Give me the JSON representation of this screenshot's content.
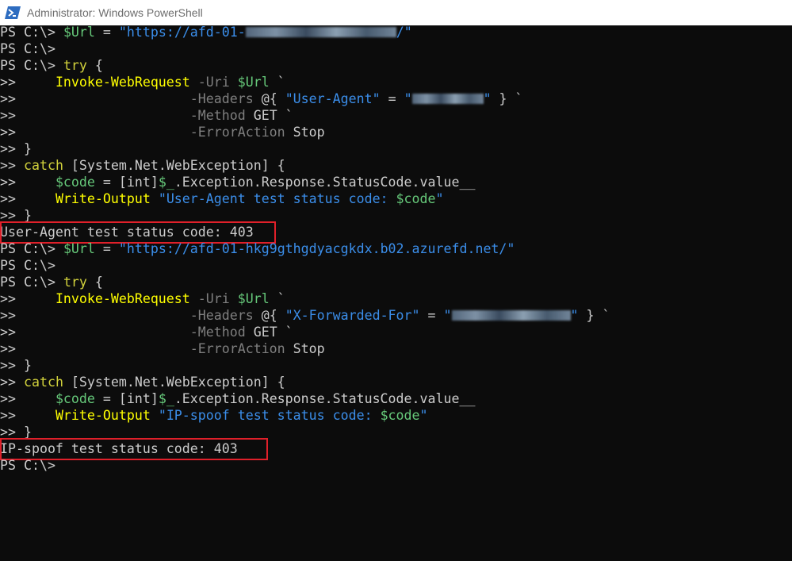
{
  "window": {
    "title": "Administrator: Windows PowerShell",
    "icon": "powershell-icon"
  },
  "colors": {
    "keyword": "#ffff00",
    "variable": "#66c97a",
    "string": "#3b8eea",
    "parameter": "#7f7f7f",
    "text": "#cccccc",
    "highlight": "#e0202a"
  },
  "console": {
    "l1": {
      "p1": "PS C:\\> ",
      "p2": "$Url",
      "p3": " = ",
      "p4": "\"https://afd-01-",
      "p6": "/\""
    },
    "l2": {
      "p1": "PS C:\\>"
    },
    "l3": {
      "p1": "PS C:\\> ",
      "p2": "try",
      "p3": " {"
    },
    "l4": {
      "p1": ">>     ",
      "p2": "Invoke-WebRequest",
      "p3": " -Uri ",
      "p4": "$Url",
      "p5": " `"
    },
    "l5": {
      "p1": ">>                      ",
      "p2": "-Headers",
      "p3": " @{ ",
      "p4": "\"User-Agent\"",
      "p5": " = ",
      "p6": "\"",
      "p8": "\"",
      "p9": " } `"
    },
    "l6": {
      "p1": ">>                      ",
      "p2": "-Method",
      "p3": " GET `"
    },
    "l7": {
      "p1": ">>                      ",
      "p2": "-ErrorAction",
      "p3": " Stop"
    },
    "l8": {
      "p1": ">> }"
    },
    "l9": {
      "p1": ">> ",
      "p2": "catch",
      "p3": " [System.Net.WebException] {"
    },
    "l10": {
      "p1": ">>     ",
      "p2": "$code",
      "p3": " = [int]",
      "p4": "$_",
      "p5": ".Exception.Response.StatusCode.value__"
    },
    "l11": {
      "p1": ">>     ",
      "p2": "Write-Output",
      "p3": " ",
      "p4": "\"User-Agent test status code: ",
      "p5": "$code",
      "p6": "\""
    },
    "l12": {
      "p1": ">> }"
    },
    "l13": {
      "p1": "User-Agent test status code: 403"
    },
    "l14": {
      "p1": "PS C:\\> ",
      "p2": "$Url",
      "p3": " = ",
      "p4": "\"https://afd-01-hkg9gthgdyacgkdx.b02.azurefd.net/\""
    },
    "l15": {
      "p1": "PS C:\\>"
    },
    "l16": {
      "p1": "PS C:\\> ",
      "p2": "try",
      "p3": " {"
    },
    "l17": {
      "p1": ">>     ",
      "p2": "Invoke-WebRequest",
      "p3": " -Uri ",
      "p4": "$Url",
      "p5": " `"
    },
    "l18": {
      "p1": ">>                      ",
      "p2": "-Headers",
      "p3": " @{ ",
      "p4": "\"X-Forwarded-For\"",
      "p5": " = ",
      "p6": "\"",
      "p8": "\"",
      "p9": " } `"
    },
    "l19": {
      "p1": ">>                      ",
      "p2": "-Method",
      "p3": " GET `"
    },
    "l20": {
      "p1": ">>                      ",
      "p2": "-ErrorAction",
      "p3": " Stop"
    },
    "l21": {
      "p1": ">> }"
    },
    "l22": {
      "p1": ">> ",
      "p2": "catch",
      "p3": " [System.Net.WebException] {"
    },
    "l23": {
      "p1": ">>     ",
      "p2": "$code",
      "p3": " = [int]",
      "p4": "$_",
      "p5": ".Exception.Response.StatusCode.value__"
    },
    "l24": {
      "p1": ">>     ",
      "p2": "Write-Output",
      "p3": " ",
      "p4": "\"IP-spoof test status code: ",
      "p5": "$code",
      "p6": "\""
    },
    "l25": {
      "p1": ">> }"
    },
    "l26": {
      "p1": "IP-spoof test status code: 403"
    },
    "l27": {
      "p1": "PS C:\\>"
    }
  }
}
